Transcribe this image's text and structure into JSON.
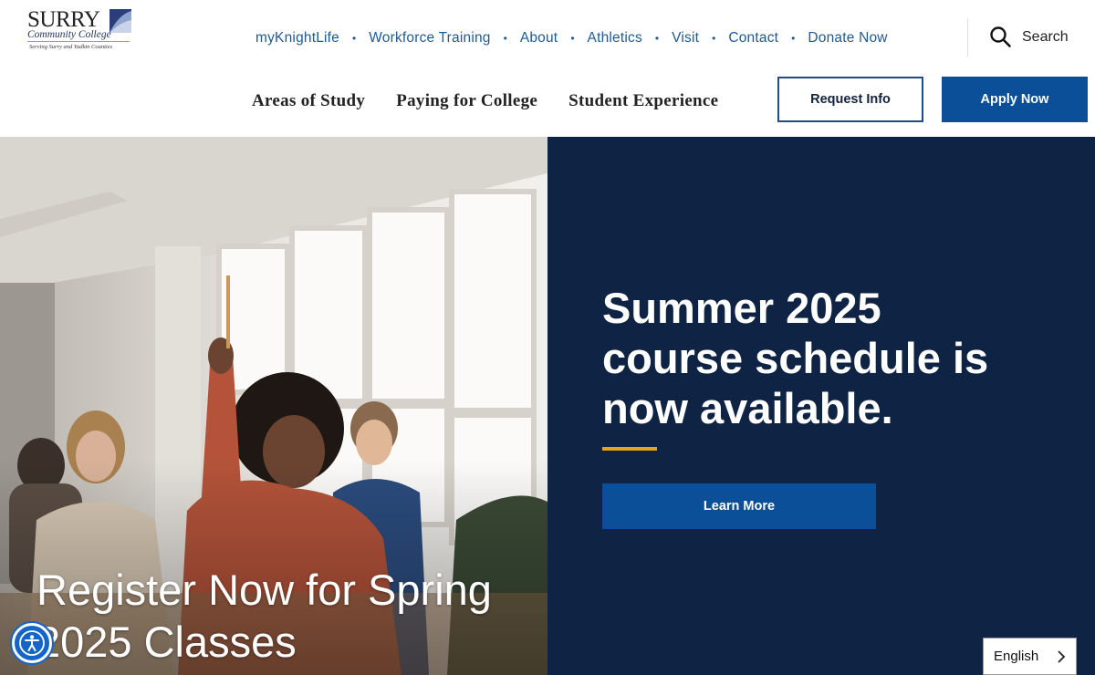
{
  "logo": {
    "name": "SURRY",
    "subtitle": "Community College",
    "tagline": "Serving Surry and Yadkin Counties"
  },
  "utility_nav": [
    {
      "label": "myKnightLife"
    },
    {
      "label": "Workforce Training"
    },
    {
      "label": "About"
    },
    {
      "label": "Athletics"
    },
    {
      "label": "Visit"
    },
    {
      "label": "Contact"
    },
    {
      "label": "Donate Now"
    }
  ],
  "utility_separator": "•",
  "search": {
    "label": "Search",
    "icon": "search-icon"
  },
  "main_nav": [
    {
      "label": "Areas of Study"
    },
    {
      "label": "Paying for College"
    },
    {
      "label": "Student Experience"
    }
  ],
  "buttons": {
    "request_info": "Request Info",
    "apply_now": "Apply Now"
  },
  "hero_left": {
    "headline": "Register Now for Spring 2025 Classes"
  },
  "hero_right": {
    "headline": "Summer 2025 course schedule is now available.",
    "cta": "Learn More"
  },
  "accessibility": {
    "icon": "accessibility-icon"
  },
  "language": {
    "selected": "English"
  },
  "colors": {
    "brand_navy": "#0f2444",
    "brand_blue": "#0b4f98",
    "link_blue": "#1f5a92",
    "accent_gold": "#e7a319"
  }
}
